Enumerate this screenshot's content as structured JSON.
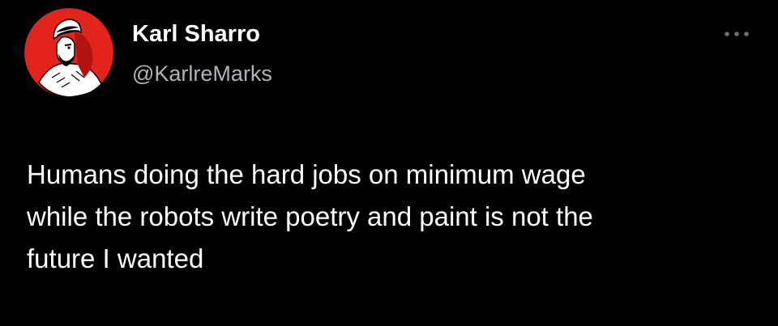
{
  "tweet": {
    "author": {
      "display_name": "Karl Sharro",
      "handle": "@KarlreMarks",
      "avatar_icon": "profile-avatar-illustration-icon",
      "avatar_bg_color": "#e2241c"
    },
    "more_icon": "ellipsis-icon",
    "text": "Humans doing the hard jobs on minimum wage\nwhile the robots write poetry and paint is not the\nfuture I wanted"
  },
  "colors": {
    "background": "#000000",
    "primary_text": "#ffffff",
    "secondary_text": "#b0b3b8"
  }
}
